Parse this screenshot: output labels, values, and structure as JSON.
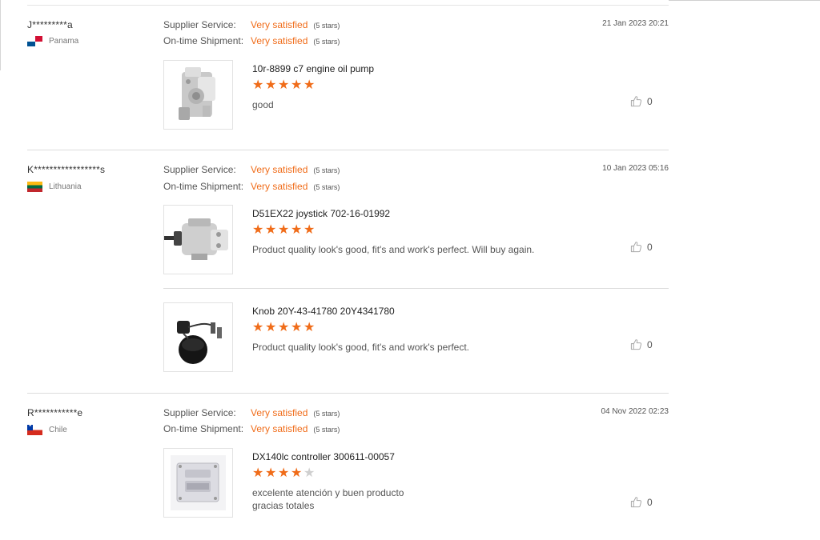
{
  "reviews": [
    {
      "user": "J*********a",
      "country": "Panama",
      "flag_icon": "panama-flag-icon",
      "date": "21 Jan 2023 20:21",
      "supplier_service": {
        "label": "Supplier Service:",
        "value": "Very satisfied",
        "stars": "(5 stars)"
      },
      "shipment": {
        "label": "On-time Shipment:",
        "value": "Very satisfied",
        "stars": "(5 stars)"
      },
      "products": [
        {
          "title": "10r-8899 c7 engine oil pump",
          "rating": 5,
          "comment": "good",
          "likes": "0",
          "image_icon": "engine-oil-pump-image"
        }
      ]
    },
    {
      "user": "K*****************s",
      "country": "Lithuania",
      "flag_icon": "lithuania-flag-icon",
      "date": "10 Jan 2023 05:16",
      "supplier_service": {
        "label": "Supplier Service:",
        "value": "Very satisfied",
        "stars": "(5 stars)"
      },
      "shipment": {
        "label": "On-time Shipment:",
        "value": "Very satisfied",
        "stars": "(5 stars)"
      },
      "products": [
        {
          "title": "D51EX22 joystick 702-16-01992",
          "rating": 5,
          "comment": "Product quality look's good, fit's and work's perfect. Will buy again.",
          "likes": "0",
          "image_icon": "joystick-valve-image"
        },
        {
          "title": "Knob 20Y-43-41780 20Y4341780",
          "rating": 5,
          "comment": "Product quality look's good, fit's and work's perfect.",
          "likes": "0",
          "image_icon": "knob-image"
        }
      ]
    },
    {
      "user": "R***********e",
      "country": "Chile",
      "flag_icon": "chile-flag-icon",
      "date": "04 Nov 2022 02:23",
      "supplier_service": {
        "label": "Supplier Service:",
        "value": "Very satisfied",
        "stars": "(5 stars)"
      },
      "shipment": {
        "label": "On-time Shipment:",
        "value": "Very satisfied",
        "stars": "(5 stars)"
      },
      "products": [
        {
          "title": "DX140lc controller 300611-00057",
          "rating": 4,
          "comment_lines": [
            "excelente atención y buen producto",
            "gracias totales"
          ],
          "likes": "0",
          "image_icon": "controller-image"
        }
      ]
    }
  ],
  "colors": {
    "accent": "#f06c19",
    "star_empty": "#cfcfcf",
    "divider": "#dcdcdc"
  },
  "icons": {
    "like": "thumbs-up-icon",
    "star": "star-icon"
  }
}
